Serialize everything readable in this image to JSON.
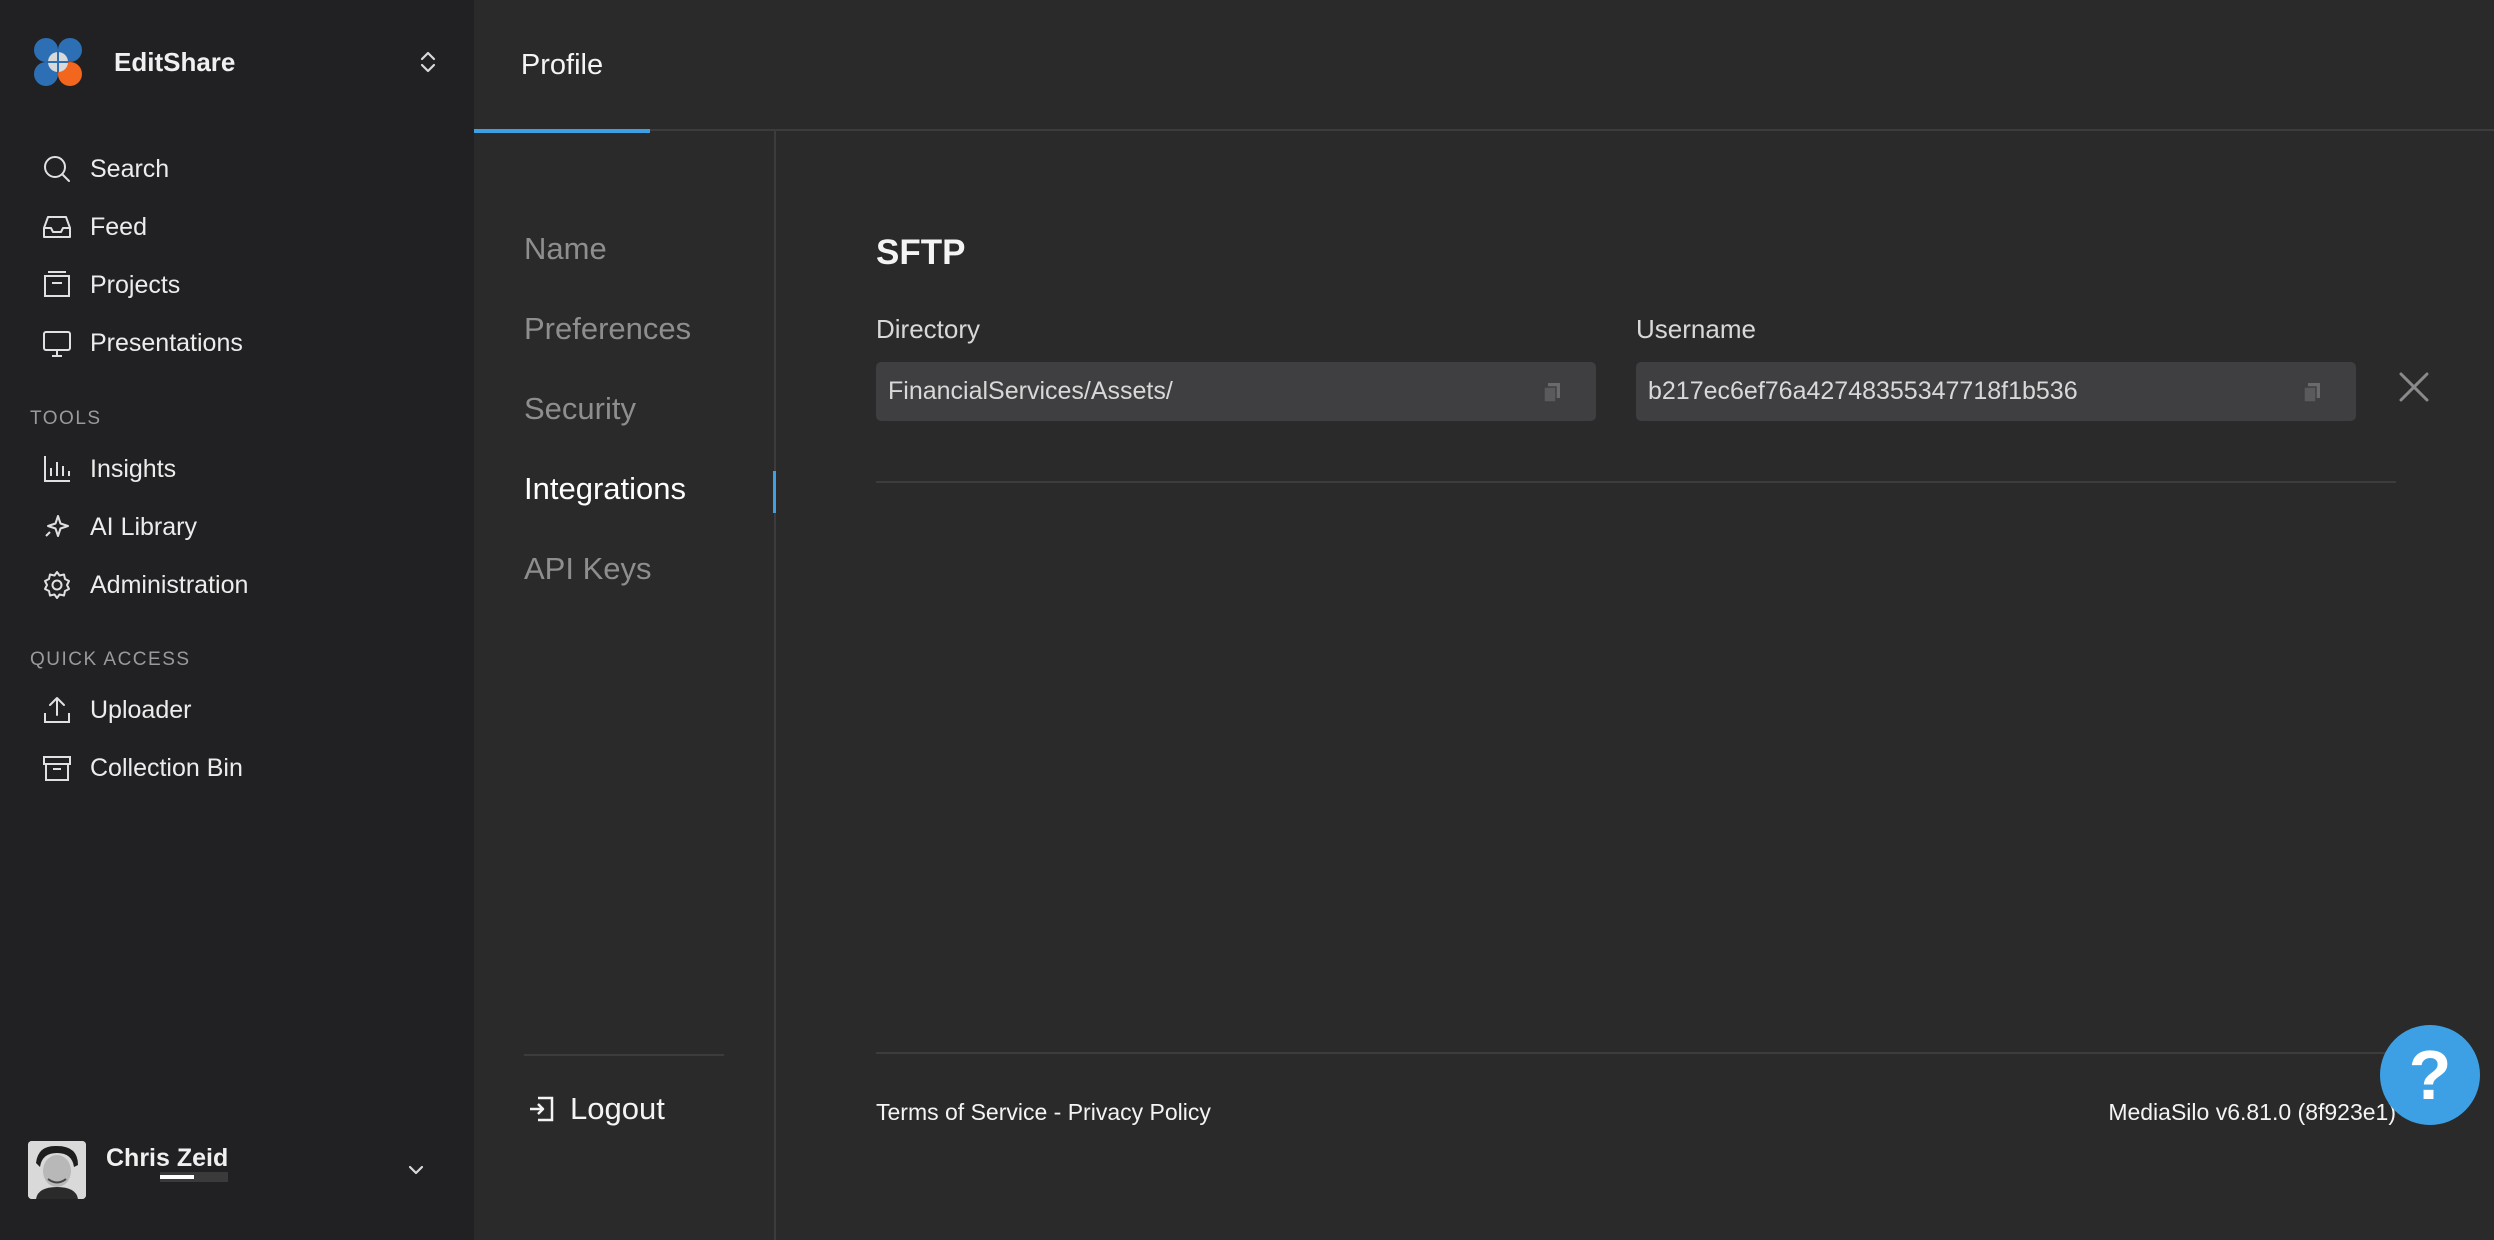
{
  "org": {
    "name": "EditShare"
  },
  "sidebar": {
    "items": [
      {
        "label": "Search"
      },
      {
        "label": "Feed"
      },
      {
        "label": "Projects"
      },
      {
        "label": "Presentations"
      }
    ],
    "tools_heading": "TOOLS",
    "tools": [
      {
        "label": "Insights"
      },
      {
        "label": "AI Library"
      },
      {
        "label": "Administration"
      }
    ],
    "quick_heading": "QUICK ACCESS",
    "quick": [
      {
        "label": "Uploader"
      },
      {
        "label": "Collection Bin"
      }
    ]
  },
  "user": {
    "name": "Chris Zeid"
  },
  "header": {
    "tab": "Profile"
  },
  "subnav": {
    "items": [
      {
        "label": "Name"
      },
      {
        "label": "Preferences"
      },
      {
        "label": "Security"
      },
      {
        "label": "Integrations"
      },
      {
        "label": "API Keys"
      }
    ],
    "active": "Integrations",
    "logout": "Logout"
  },
  "sftp": {
    "title": "SFTP",
    "directory_label": "Directory",
    "directory_value": "FinancialServices/Assets/",
    "username_label": "Username",
    "username_value": "b217ec6ef76a42748355347718f1b536"
  },
  "footer": {
    "terms": "Terms of Service",
    "separator": " - ",
    "privacy": "Privacy Policy",
    "version": "MediaSilo v6.81.0 (8f923e1)"
  },
  "help": {
    "label": "?"
  },
  "colors": {
    "accent": "#3ea0e4",
    "sidebar_bg": "#212123",
    "main_bg": "#2a2a2b",
    "field_bg": "#3f3f41"
  }
}
